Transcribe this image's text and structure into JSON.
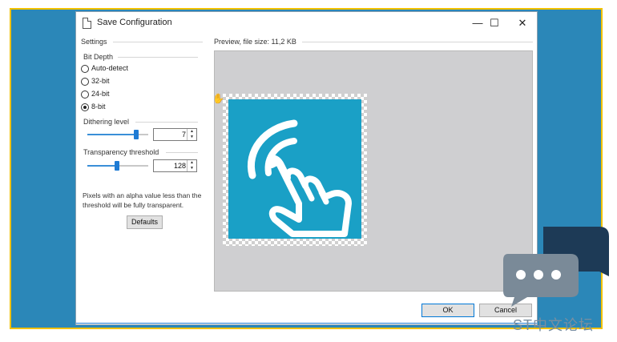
{
  "window": {
    "title": "Save Configuration",
    "minimize_glyph": "—",
    "maximize_glyph": "☐",
    "close_glyph": "✕"
  },
  "settings": {
    "section_label": "Settings",
    "bit_depth": {
      "label": "Bit Depth",
      "options": [
        {
          "label": "Auto-detect",
          "selected": false
        },
        {
          "label": "32-bit",
          "selected": false
        },
        {
          "label": "24-bit",
          "selected": false
        },
        {
          "label": "8-bit",
          "selected": true
        }
      ]
    },
    "dithering": {
      "label": "Dithering level",
      "value": "7"
    },
    "transparency": {
      "label": "Transparency threshold",
      "value": "128"
    },
    "note": "Pixels with an alpha value less than the threshold will be fully transparent.",
    "defaults_label": "Defaults"
  },
  "preview": {
    "label": "Preview, file size: 11,2 KB"
  },
  "footer": {
    "ok_label": "OK",
    "cancel_label": "Cancel"
  },
  "watermark": {
    "text": "ST中文论坛"
  },
  "colors": {
    "frame_border": "#f2c200",
    "background_blue": "#2b87b8",
    "logo_teal": "#1aa0c6",
    "accent": "#0078d7"
  }
}
